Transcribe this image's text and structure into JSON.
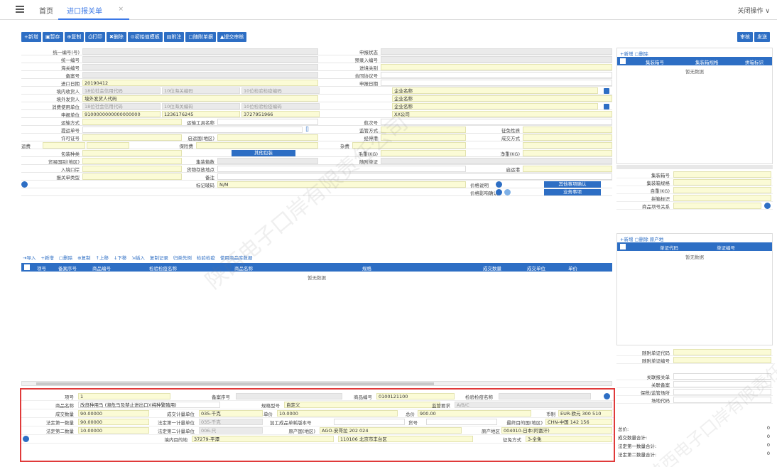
{
  "topbar": {
    "home": "首页",
    "active_tab": "进口报关单",
    "close_ops": "关闭操作 ∨"
  },
  "toolbar": {
    "buttons": [
      "新增",
      "暂存",
      "复制",
      "打印",
      "删除",
      "初始值模板",
      "附注",
      "随附单据",
      "提交审核"
    ],
    "right_buttons": [
      "审核",
      "发送"
    ]
  },
  "form": {
    "r1": {
      "a": "统一编号(号)",
      "b": "申报状态"
    },
    "r2": {
      "a": "统一编号",
      "b": "预录入编号"
    },
    "r3": {
      "a": "海关编号",
      "b": "进境关别"
    },
    "r4": {
      "a": "备案号",
      "b": "合同协议号"
    },
    "r5": {
      "a": "进口日期",
      "a_val": "20190412",
      "b": "申报日期"
    },
    "r6": {
      "a": "境内收货人",
      "a_ph": "18位社会信用代码",
      "b_ph": "10位海关编码",
      "c_ph": "10位检验检疫编码",
      "d_ph": "企业名称"
    },
    "r7": {
      "a": "境外发货人",
      "a_ph": "境外发货人代码",
      "d_ph": "企业名称"
    },
    "r8": {
      "a": "消费使用单位",
      "a_ph": "18位社会信用代码",
      "b_ph": "10位海关编码",
      "c_ph": "10位检验检疫编码",
      "d_ph": "企业名称"
    },
    "r9": {
      "a": "申报单位",
      "a_val": "9100000000000000000",
      "b_val": "1236176245",
      "c_val": "3727951966",
      "d_val": "XX公司"
    },
    "r10": {
      "a": "运输方式",
      "b": "运输工具名称",
      "c": "航次号"
    },
    "r11": {
      "a": "提运单号",
      "b": "监管方式",
      "c": "征免性质"
    },
    "r12": {
      "a": "许可证号",
      "b": "启运国(地区)",
      "c": "经停港",
      "d": "成交方式"
    },
    "r13": {
      "a": "运费",
      "b": "保险费",
      "c": "杂费"
    },
    "r14": {
      "a": "包装种类",
      "btn": "其他包装",
      "b": "毛重(KG)",
      "c": "净重(KG)"
    },
    "r15": {
      "a": "贸易国别(地区)",
      "b": "集装箱数",
      "c": "随附单证"
    },
    "r16": {
      "a": "入境口岸",
      "b": "货物存放地点",
      "c": "启运港"
    },
    "r17": {
      "a": "报关单类型",
      "b": "备注"
    },
    "r18": {
      "b": "标记唛码",
      "b_val": "N/M",
      "c": "价格说明",
      "btn1": "其他事项确认",
      "d": "特殊关系确认"
    },
    "r19": {
      "c": "价格影响确认",
      "btn2": "业务事项"
    }
  },
  "grid": {
    "actions": [
      "导入",
      "新增",
      "删除",
      "复制",
      "上移",
      "下移",
      "插入",
      "复制记录",
      "归类先例",
      "检验检疫",
      "使用商品库数据"
    ],
    "headers": [
      "项号",
      "备案序号",
      "商品编号",
      "检验检疫名称",
      "商品名称",
      "规格",
      "成交数量",
      "成交单位",
      "单价"
    ],
    "empty": "暂无数据"
  },
  "detail": {
    "r1": {
      "a": "项号",
      "a_val": "1",
      "b": "备案序号",
      "c": "商品编号",
      "c_val": "0100121100",
      "d": "检验检疫名称"
    },
    "r2": {
      "a": "商品名称",
      "a_val": "改良种用马 (濒危马及禁止进出口)(纯种繁殖用)",
      "b": "规格型号",
      "b_val": "自定义",
      "c": "监管要求",
      "c_val": "A/B/C"
    },
    "r3": {
      "a": "成交数量",
      "a_val": "90.00000",
      "b": "成交计量单位",
      "b_val": "035-千克",
      "c": "单价",
      "c_val": "10.0000",
      "d": "总价",
      "d_val": "900.00",
      "e": "币制",
      "e_val": "EUR-欧元 300 510"
    },
    "r4": {
      "a": "法定第一数量",
      "a_val": "90.00000",
      "b": "法定第一计量单位",
      "b_val": "035-千克",
      "c": "加工成品单耗版本号",
      "d": "货号",
      "e": "最终目的国(地区)",
      "e_val": "CHN-中国 142 156"
    },
    "r5": {
      "a": "法定第二数量",
      "a_val": "10.00000",
      "b": "法定第二计量单位",
      "b_val": "006-只",
      "c": "原产国(地区)",
      "c_val": "AGO-安哥拉 202 024",
      "d": "原产地区",
      "d_val": "004010-日本(阿富汗)"
    },
    "r6": {
      "b": "境内目的地",
      "b_val": "37279-平潭",
      "c_val": "110106 北京市丰台区",
      "d": "征免方式",
      "d_val": "3-全免"
    }
  },
  "right": {
    "panel1": {
      "actions": [
        "新增",
        "删除"
      ],
      "headers": [
        "集装箱号",
        "集装箱规格",
        "拼箱标识"
      ],
      "empty": "暂无数据"
    },
    "panel1_fields": [
      "集装箱号",
      "集装箱规格",
      "自重(KG)",
      "拼箱标识",
      "商品项号关系"
    ],
    "panel2": {
      "actions": [
        "新增",
        "删除",
        "原产地"
      ],
      "headers": [
        "单证代码",
        "单证编号"
      ],
      "empty": "暂无数据"
    },
    "panel2_fields": [
      "随附单证代码",
      "随附单证编号"
    ],
    "panel3_fields": [
      "关联报关单",
      "关联备案",
      "保税/监管场所",
      "场地代码"
    ],
    "sums": [
      {
        "k": "总价:",
        "v": "0"
      },
      {
        "k": "成交数量合计:",
        "v": "0"
      },
      {
        "k": "法定第一数量合计:",
        "v": "0"
      },
      {
        "k": "法定第二数量合计:",
        "v": "0"
      }
    ]
  },
  "watermark": "陕西电子口岸有限责任公司"
}
